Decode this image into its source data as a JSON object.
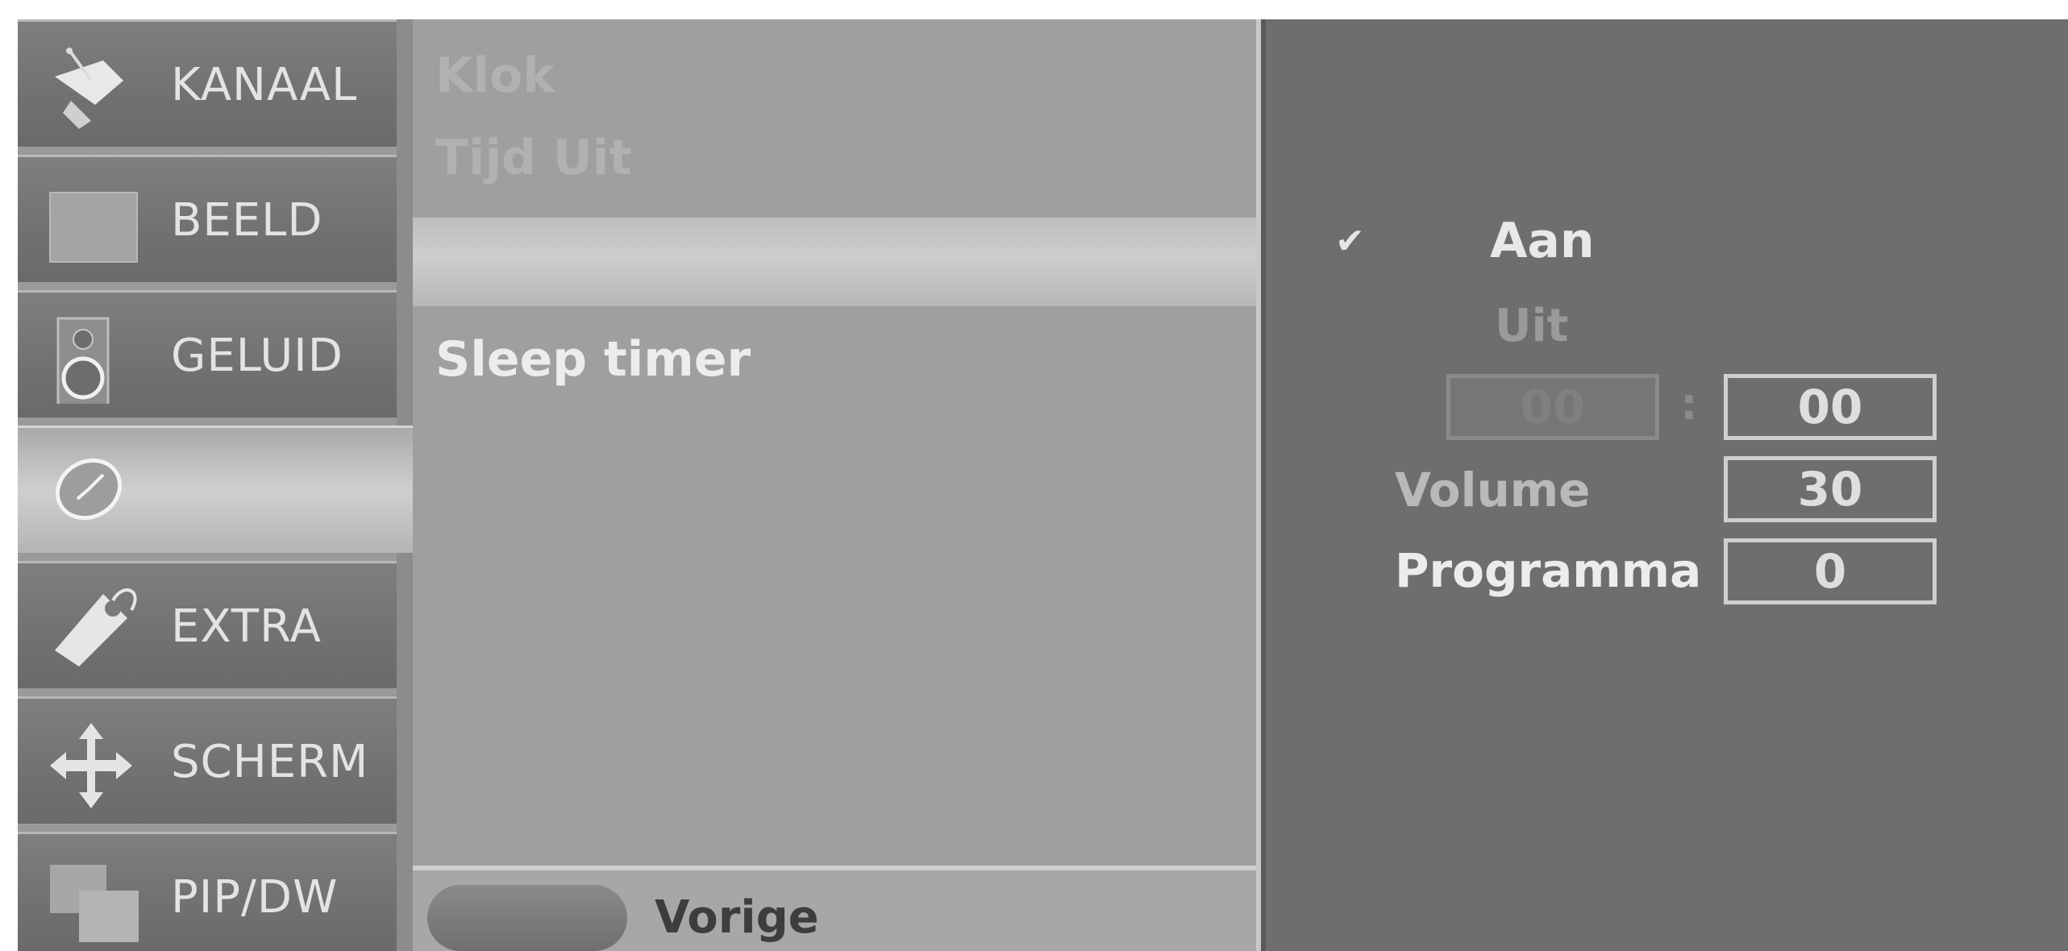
{
  "sidebar": {
    "items": [
      {
        "label": "KANAAL",
        "icon": "satellite-dish-icon"
      },
      {
        "label": "BEELD",
        "icon": "picture-square-icon"
      },
      {
        "label": "GELUID",
        "icon": "speaker-icon"
      },
      {
        "label": "",
        "icon": "clock-icon",
        "active": true
      },
      {
        "label": "EXTRA",
        "icon": "tag-icon"
      },
      {
        "label": "SCHERM",
        "icon": "move-arrows-icon"
      },
      {
        "label": "PIP/DW",
        "icon": "pip-windows-icon"
      }
    ]
  },
  "submenu": {
    "items": [
      {
        "label": "Klok"
      },
      {
        "label": "Tijd Uit"
      },
      {
        "label": ""
      },
      {
        "label": "Sleep timer"
      }
    ],
    "back_label": "Vorige"
  },
  "panel": {
    "options": {
      "on_label": "Aan",
      "off_label": "Uit",
      "check_icon": "checkmark-icon"
    },
    "time": {
      "hours": "00",
      "separator": ":",
      "minutes": "00"
    },
    "volume": {
      "label": "Volume",
      "value": "30"
    },
    "programme": {
      "label": "Programma",
      "value": "0"
    }
  },
  "colors": {
    "menu_bg": "#8c8c8c",
    "panel_bg": "#6e6e6e",
    "text_bright": "#ececec"
  }
}
